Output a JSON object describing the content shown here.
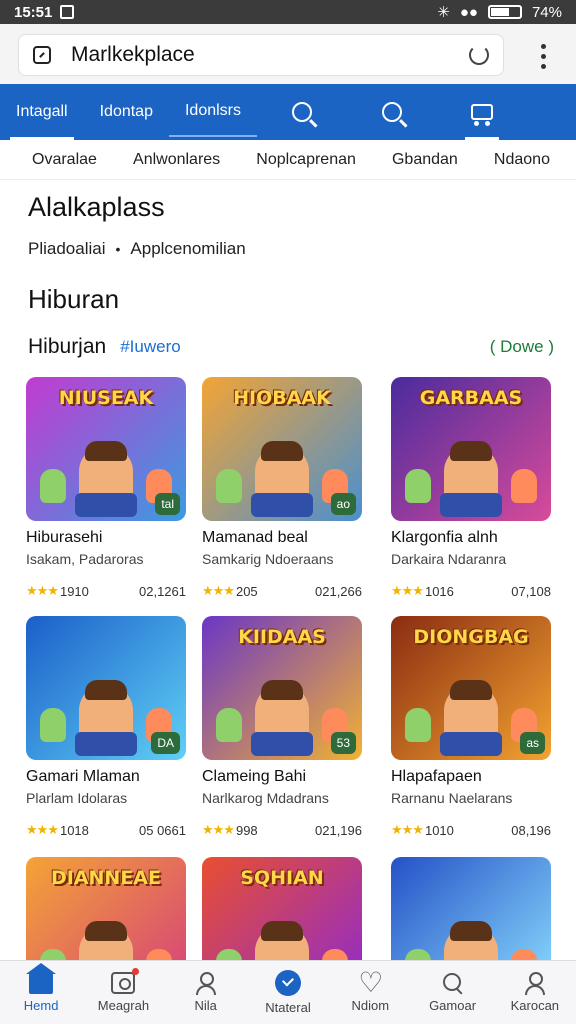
{
  "status_bar": {
    "time": "15:51",
    "battery": "74%"
  },
  "browser": {
    "url": "Marlkekplace"
  },
  "nav": {
    "tabs": [
      "Intagall",
      "Idontap",
      "Idonlsrs"
    ]
  },
  "categories": [
    "Ovaralae",
    "Anlwonlares",
    "Noplcaprenan",
    "Gbandan",
    "Ndaono"
  ],
  "page": {
    "title": "Alalkaplass",
    "breadcrumb": [
      "Pliadoaliai",
      "Applcenomilian"
    ],
    "section_title": "Hiburan"
  },
  "subsection": {
    "title": "Hiburjan",
    "tag": "#Iuwero",
    "more": "( Dowe )"
  },
  "apps": [
    {
      "banner": "NIUSEAK",
      "badge": "tal",
      "name": "Hiburasehi",
      "sub": "Isakam, Padaroras",
      "rating": "1910",
      "price": "02,1261",
      "bg": [
        "#c23bd1",
        "#3b9be0"
      ]
    },
    {
      "banner": "HIOBAAK",
      "badge": "ao",
      "name": "Mamanad beal",
      "sub": "Samkarig Ndoeraans",
      "rating": "205",
      "price": "021,266",
      "bg": [
        "#f3a436",
        "#4a8fcf"
      ]
    },
    {
      "banner": "GARBAAS",
      "badge": "",
      "name": "Klargonfia alnh",
      "sub": "Darkaira Ndaranra",
      "rating": "1016",
      "price": "07,108",
      "bg": [
        "#4a2b9e",
        "#d84b9a"
      ]
    },
    {
      "banner": "",
      "badge": "DA",
      "name": "Gamari Mlaman",
      "sub": "Plarlam Idolaras",
      "rating": "1018",
      "price": "05 0661",
      "bg": [
        "#1b5fc9",
        "#5fd0f5"
      ]
    },
    {
      "banner": "KIIDAAS",
      "badge": "53",
      "name": "Clameing Bahi",
      "sub": "Narlkarog Mdadrans",
      "rating": "998",
      "price": "021,196",
      "bg": [
        "#6a36c6",
        "#f2b233"
      ]
    },
    {
      "banner": "DIONGBAG",
      "badge": "as",
      "name": "Hlapafapaen",
      "sub": "Rarnanu Naelarans",
      "rating": "1010",
      "price": "08,196",
      "bg": [
        "#8a2c12",
        "#f3a330"
      ]
    },
    {
      "banner": "DIANNEAE",
      "badge": "",
      "name": "",
      "sub": "",
      "rating": "",
      "price": "",
      "bg": [
        "#f3a436",
        "#d63e7c"
      ]
    },
    {
      "banner": "SQHIAN",
      "badge": "",
      "name": "",
      "sub": "",
      "rating": "",
      "price": "",
      "bg": [
        "#e94f2f",
        "#8d2ad1"
      ]
    },
    {
      "banner": "",
      "badge": "",
      "name": "",
      "sub": "",
      "rating": "",
      "price": "",
      "bg": [
        "#2551c7",
        "#8de0ff"
      ]
    }
  ],
  "bottom_nav": [
    "Hemd",
    "Meagrah",
    "Nila",
    "Ntateral",
    "Ndiom",
    "Gamoar",
    "Karocan"
  ],
  "colors": {
    "accent": "#1b64c4",
    "star": "#f0b400",
    "more_link": "#1e7b3a"
  }
}
